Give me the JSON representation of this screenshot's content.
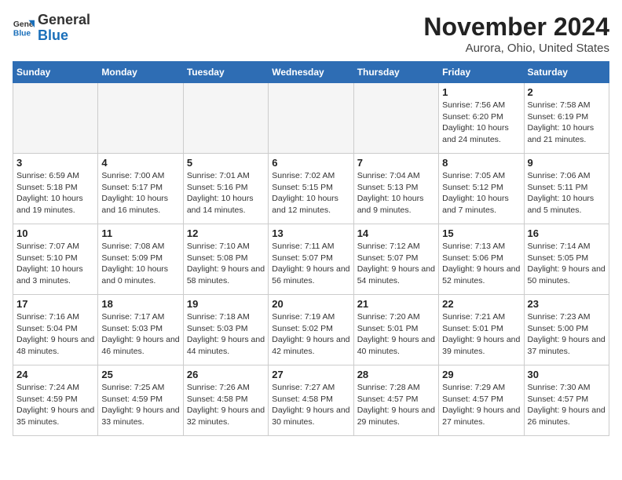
{
  "header": {
    "logo_general": "General",
    "logo_blue": "Blue",
    "month_title": "November 2024",
    "location": "Aurora, Ohio, United States"
  },
  "days_of_week": [
    "Sunday",
    "Monday",
    "Tuesday",
    "Wednesday",
    "Thursday",
    "Friday",
    "Saturday"
  ],
  "weeks": [
    [
      {
        "day": "",
        "info": ""
      },
      {
        "day": "",
        "info": ""
      },
      {
        "day": "",
        "info": ""
      },
      {
        "day": "",
        "info": ""
      },
      {
        "day": "",
        "info": ""
      },
      {
        "day": "1",
        "info": "Sunrise: 7:56 AM\nSunset: 6:20 PM\nDaylight: 10 hours and 24 minutes."
      },
      {
        "day": "2",
        "info": "Sunrise: 7:58 AM\nSunset: 6:19 PM\nDaylight: 10 hours and 21 minutes."
      }
    ],
    [
      {
        "day": "3",
        "info": "Sunrise: 6:59 AM\nSunset: 5:18 PM\nDaylight: 10 hours and 19 minutes."
      },
      {
        "day": "4",
        "info": "Sunrise: 7:00 AM\nSunset: 5:17 PM\nDaylight: 10 hours and 16 minutes."
      },
      {
        "day": "5",
        "info": "Sunrise: 7:01 AM\nSunset: 5:16 PM\nDaylight: 10 hours and 14 minutes."
      },
      {
        "day": "6",
        "info": "Sunrise: 7:02 AM\nSunset: 5:15 PM\nDaylight: 10 hours and 12 minutes."
      },
      {
        "day": "7",
        "info": "Sunrise: 7:04 AM\nSunset: 5:13 PM\nDaylight: 10 hours and 9 minutes."
      },
      {
        "day": "8",
        "info": "Sunrise: 7:05 AM\nSunset: 5:12 PM\nDaylight: 10 hours and 7 minutes."
      },
      {
        "day": "9",
        "info": "Sunrise: 7:06 AM\nSunset: 5:11 PM\nDaylight: 10 hours and 5 minutes."
      }
    ],
    [
      {
        "day": "10",
        "info": "Sunrise: 7:07 AM\nSunset: 5:10 PM\nDaylight: 10 hours and 3 minutes."
      },
      {
        "day": "11",
        "info": "Sunrise: 7:08 AM\nSunset: 5:09 PM\nDaylight: 10 hours and 0 minutes."
      },
      {
        "day": "12",
        "info": "Sunrise: 7:10 AM\nSunset: 5:08 PM\nDaylight: 9 hours and 58 minutes."
      },
      {
        "day": "13",
        "info": "Sunrise: 7:11 AM\nSunset: 5:07 PM\nDaylight: 9 hours and 56 minutes."
      },
      {
        "day": "14",
        "info": "Sunrise: 7:12 AM\nSunset: 5:07 PM\nDaylight: 9 hours and 54 minutes."
      },
      {
        "day": "15",
        "info": "Sunrise: 7:13 AM\nSunset: 5:06 PM\nDaylight: 9 hours and 52 minutes."
      },
      {
        "day": "16",
        "info": "Sunrise: 7:14 AM\nSunset: 5:05 PM\nDaylight: 9 hours and 50 minutes."
      }
    ],
    [
      {
        "day": "17",
        "info": "Sunrise: 7:16 AM\nSunset: 5:04 PM\nDaylight: 9 hours and 48 minutes."
      },
      {
        "day": "18",
        "info": "Sunrise: 7:17 AM\nSunset: 5:03 PM\nDaylight: 9 hours and 46 minutes."
      },
      {
        "day": "19",
        "info": "Sunrise: 7:18 AM\nSunset: 5:03 PM\nDaylight: 9 hours and 44 minutes."
      },
      {
        "day": "20",
        "info": "Sunrise: 7:19 AM\nSunset: 5:02 PM\nDaylight: 9 hours and 42 minutes."
      },
      {
        "day": "21",
        "info": "Sunrise: 7:20 AM\nSunset: 5:01 PM\nDaylight: 9 hours and 40 minutes."
      },
      {
        "day": "22",
        "info": "Sunrise: 7:21 AM\nSunset: 5:01 PM\nDaylight: 9 hours and 39 minutes."
      },
      {
        "day": "23",
        "info": "Sunrise: 7:23 AM\nSunset: 5:00 PM\nDaylight: 9 hours and 37 minutes."
      }
    ],
    [
      {
        "day": "24",
        "info": "Sunrise: 7:24 AM\nSunset: 4:59 PM\nDaylight: 9 hours and 35 minutes."
      },
      {
        "day": "25",
        "info": "Sunrise: 7:25 AM\nSunset: 4:59 PM\nDaylight: 9 hours and 33 minutes."
      },
      {
        "day": "26",
        "info": "Sunrise: 7:26 AM\nSunset: 4:58 PM\nDaylight: 9 hours and 32 minutes."
      },
      {
        "day": "27",
        "info": "Sunrise: 7:27 AM\nSunset: 4:58 PM\nDaylight: 9 hours and 30 minutes."
      },
      {
        "day": "28",
        "info": "Sunrise: 7:28 AM\nSunset: 4:57 PM\nDaylight: 9 hours and 29 minutes."
      },
      {
        "day": "29",
        "info": "Sunrise: 7:29 AM\nSunset: 4:57 PM\nDaylight: 9 hours and 27 minutes."
      },
      {
        "day": "30",
        "info": "Sunrise: 7:30 AM\nSunset: 4:57 PM\nDaylight: 9 hours and 26 minutes."
      }
    ]
  ]
}
